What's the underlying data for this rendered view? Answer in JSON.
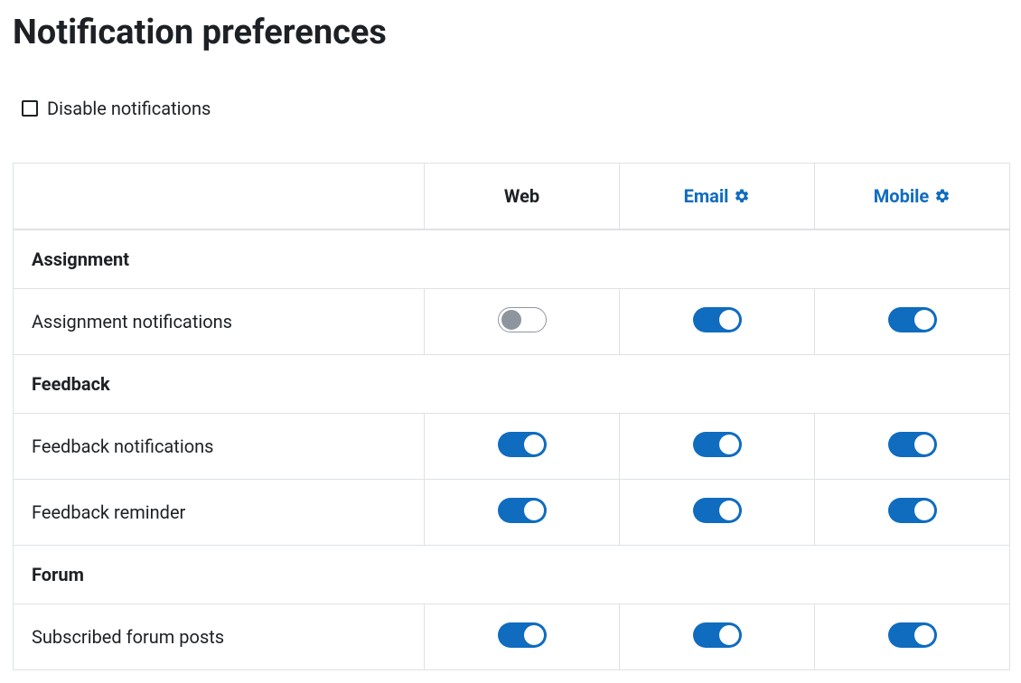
{
  "page_title": "Notification preferences",
  "disable_all": {
    "label": "Disable notifications",
    "checked": false
  },
  "channels": [
    {
      "key": "web",
      "label": "Web",
      "has_settings": false
    },
    {
      "key": "email",
      "label": "Email",
      "has_settings": true
    },
    {
      "key": "mobile",
      "label": "Mobile",
      "has_settings": true
    }
  ],
  "sections": [
    {
      "title": "Assignment",
      "rows": [
        {
          "label": "Assignment notifications",
          "web": "off",
          "email": "on",
          "mobile": "on"
        }
      ]
    },
    {
      "title": "Feedback",
      "rows": [
        {
          "label": "Feedback notifications",
          "web": "on",
          "email": "on",
          "mobile": "on"
        },
        {
          "label": "Feedback reminder",
          "web": "on",
          "email": "on",
          "mobile": "on"
        }
      ]
    },
    {
      "title": "Forum",
      "rows": [
        {
          "label": "Subscribed forum posts",
          "web": "on",
          "email": "on",
          "mobile": "on"
        }
      ]
    }
  ],
  "colors": {
    "accent": "#0f6cbf",
    "border": "#dee2e6",
    "text": "#1d2125",
    "toggle_off_border": "#8f959e"
  }
}
